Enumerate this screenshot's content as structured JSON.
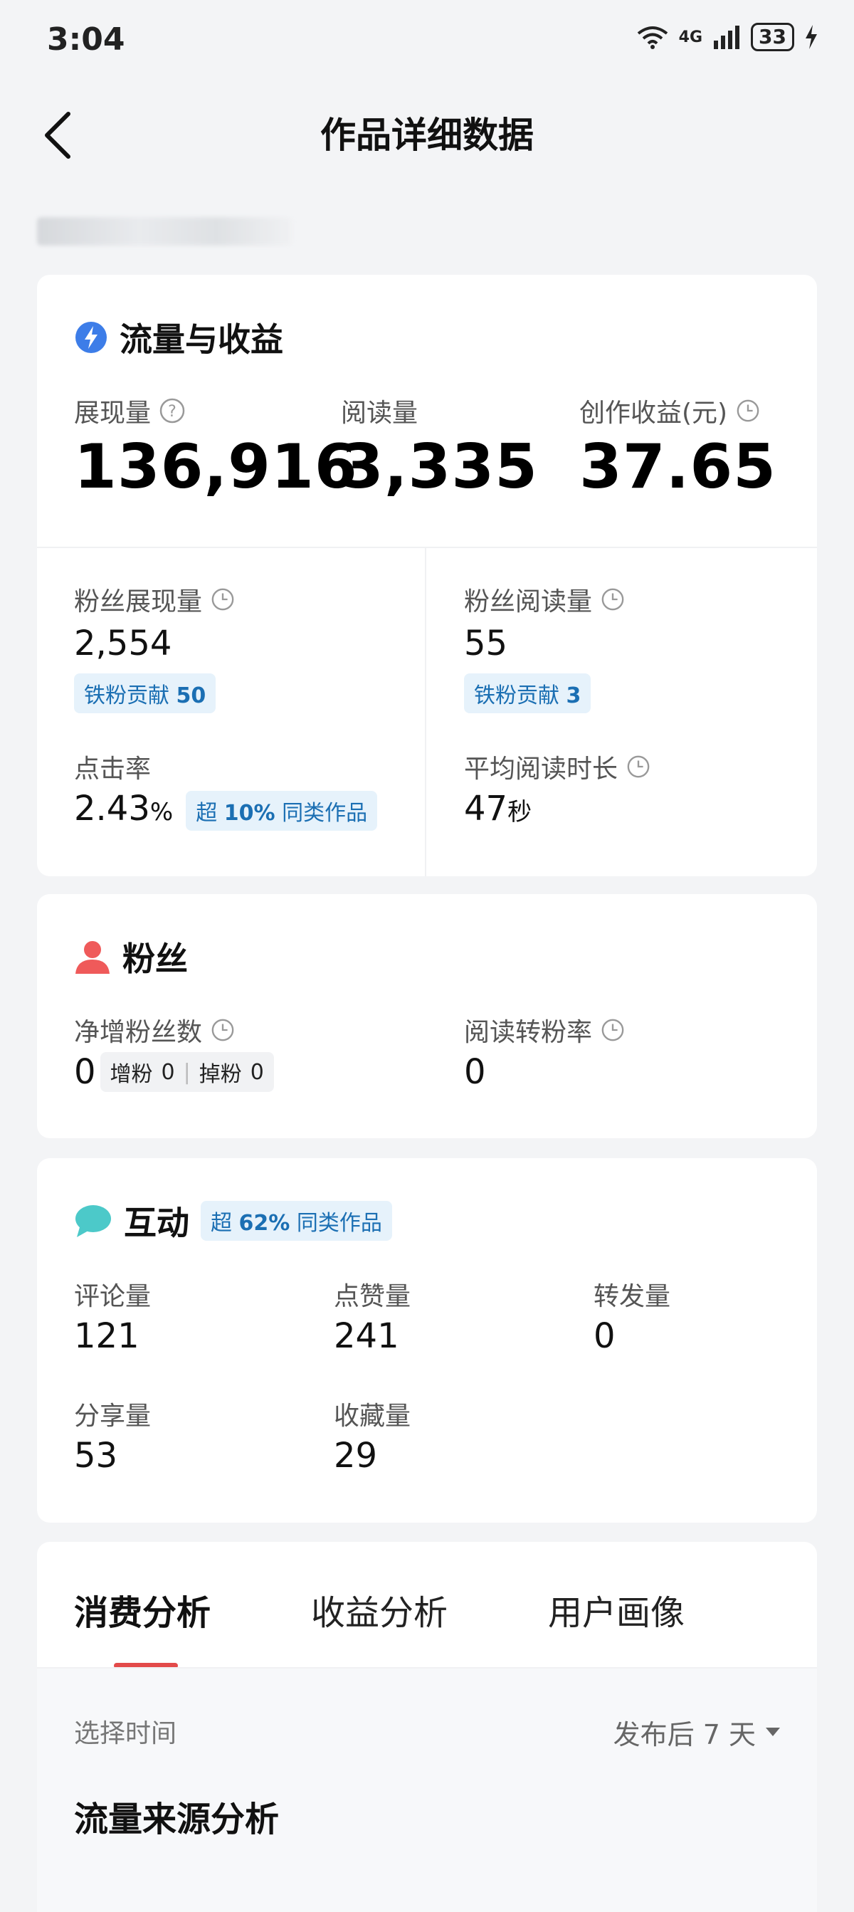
{
  "status_bar": {
    "time": "3:04",
    "network": "4G",
    "battery": "33"
  },
  "header": {
    "title": "作品详细数据"
  },
  "traffic": {
    "section_title": "流量与收益",
    "impressions_label": "展现量",
    "impressions_value": "136,916",
    "reads_label": "阅读量",
    "reads_value": "3,335",
    "earnings_label": "创作收益(元)",
    "earnings_value": "37.65",
    "fan_impressions_label": "粉丝展现量",
    "fan_impressions_value": "2,554",
    "fan_impressions_chip_text": "铁粉贡献",
    "fan_impressions_chip_num": "50",
    "fan_reads_label": "粉丝阅读量",
    "fan_reads_value": "55",
    "fan_reads_chip_text": "铁粉贡献",
    "fan_reads_chip_num": "3",
    "ctr_label": "点击率",
    "ctr_value": "2.43",
    "ctr_unit": "%",
    "ctr_chip_prefix": "超",
    "ctr_chip_pct": "10%",
    "ctr_chip_suffix": "同类作品",
    "avg_read_label": "平均阅读时长",
    "avg_read_value": "47",
    "avg_read_unit": "秒"
  },
  "fans": {
    "section_title": "粉丝",
    "net_label": "净增粉丝数",
    "net_value": "0",
    "gain_label": "增粉",
    "gain_value": "0",
    "loss_label": "掉粉",
    "loss_value": "0",
    "conv_label": "阅读转粉率",
    "conv_value": "0"
  },
  "interaction": {
    "section_title": "互动",
    "chip_prefix": "超",
    "chip_pct": "62%",
    "chip_suffix": "同类作品",
    "comments_label": "评论量",
    "comments_value": "121",
    "likes_label": "点赞量",
    "likes_value": "241",
    "reposts_label": "转发量",
    "reposts_value": "0",
    "shares_label": "分享量",
    "shares_value": "53",
    "favorites_label": "收藏量",
    "favorites_value": "29"
  },
  "analysis": {
    "tabs": [
      "消费分析",
      "收益分析",
      "用户画像"
    ],
    "active_tab": "消费分析",
    "time_label": "选择时间",
    "time_value": "发布后 7 天",
    "source_title": "流量来源分析"
  },
  "colors": {
    "accent_red": "#e34a4a",
    "chip_blue": "#1b6fb3",
    "chip_bg": "#e6f2fb",
    "fans_icon": "#ef5a5a",
    "chat_icon": "#4cc9c9",
    "flow_icon": "#3d7de8"
  }
}
